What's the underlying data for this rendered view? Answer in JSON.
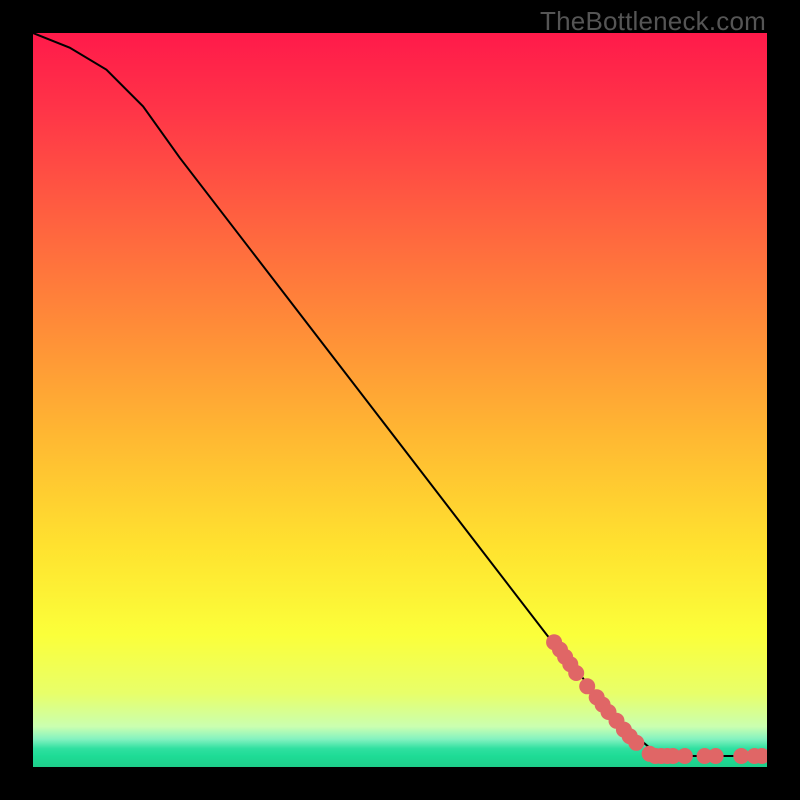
{
  "watermark": "TheBottleneck.com",
  "chart_data": {
    "type": "line",
    "title": "",
    "xlabel": "",
    "ylabel": "",
    "xlim": [
      0,
      100
    ],
    "ylim": [
      0,
      100
    ],
    "curve": [
      {
        "x": 0,
        "y": 100
      },
      {
        "x": 5,
        "y": 98
      },
      {
        "x": 10,
        "y": 95
      },
      {
        "x": 15,
        "y": 90
      },
      {
        "x": 20,
        "y": 83
      },
      {
        "x": 30,
        "y": 70
      },
      {
        "x": 40,
        "y": 57
      },
      {
        "x": 50,
        "y": 44
      },
      {
        "x": 60,
        "y": 31
      },
      {
        "x": 70,
        "y": 18
      },
      {
        "x": 80,
        "y": 6
      },
      {
        "x": 85,
        "y": 1.8
      },
      {
        "x": 90,
        "y": 1.5
      },
      {
        "x": 95,
        "y": 1.5
      },
      {
        "x": 100,
        "y": 1.5
      }
    ],
    "markers": [
      {
        "x": 71,
        "y": 17
      },
      {
        "x": 71.8,
        "y": 16
      },
      {
        "x": 72.5,
        "y": 15
      },
      {
        "x": 73.2,
        "y": 14
      },
      {
        "x": 74.0,
        "y": 12.8
      },
      {
        "x": 75.5,
        "y": 11
      },
      {
        "x": 76.8,
        "y": 9.5
      },
      {
        "x": 77.6,
        "y": 8.5
      },
      {
        "x": 78.4,
        "y": 7.5
      },
      {
        "x": 79.5,
        "y": 6.3
      },
      {
        "x": 80.5,
        "y": 5.1
      },
      {
        "x": 81.3,
        "y": 4.2
      },
      {
        "x": 82.2,
        "y": 3.3
      },
      {
        "x": 84.0,
        "y": 1.8
      },
      {
        "x": 84.8,
        "y": 1.5
      },
      {
        "x": 85.6,
        "y": 1.5
      },
      {
        "x": 86.4,
        "y": 1.5
      },
      {
        "x": 87.2,
        "y": 1.5
      },
      {
        "x": 88.8,
        "y": 1.5
      },
      {
        "x": 91.5,
        "y": 1.5
      },
      {
        "x": 93.0,
        "y": 1.5
      },
      {
        "x": 96.5,
        "y": 1.5
      },
      {
        "x": 98.3,
        "y": 1.5
      },
      {
        "x": 99.3,
        "y": 1.5
      }
    ],
    "gradient_stops": [
      {
        "offset": 0.0,
        "color": "#ff1a4a"
      },
      {
        "offset": 0.1,
        "color": "#ff3348"
      },
      {
        "offset": 0.25,
        "color": "#ff6040"
      },
      {
        "offset": 0.4,
        "color": "#ff8c38"
      },
      {
        "offset": 0.55,
        "color": "#ffb832"
      },
      {
        "offset": 0.7,
        "color": "#ffe22f"
      },
      {
        "offset": 0.82,
        "color": "#fbff3a"
      },
      {
        "offset": 0.9,
        "color": "#e8ff6a"
      },
      {
        "offset": 0.945,
        "color": "#caffb0"
      },
      {
        "offset": 0.962,
        "color": "#84f2c0"
      },
      {
        "offset": 0.975,
        "color": "#2fe0a0"
      },
      {
        "offset": 0.985,
        "color": "#1edc96"
      },
      {
        "offset": 1.0,
        "color": "#1ece8a"
      }
    ],
    "marker_color": "#e06666",
    "curve_color": "#000000"
  }
}
